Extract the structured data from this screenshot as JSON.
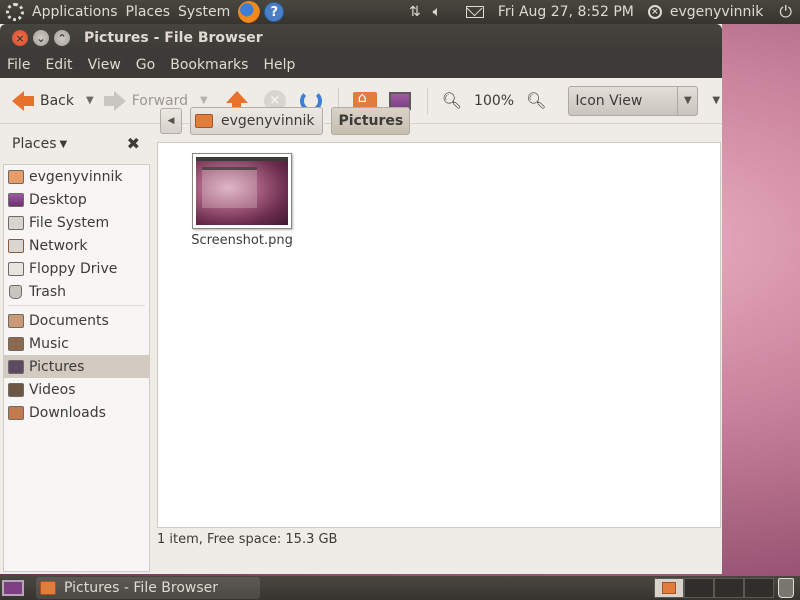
{
  "top_panel": {
    "applications": "Applications",
    "places": "Places",
    "system": "System",
    "help_icon_text": "?",
    "datetime": "Fri Aug 27,  8:52 PM",
    "username": "evgenyvinnik"
  },
  "window": {
    "title": "Pictures - File Browser"
  },
  "menubar": {
    "items": [
      "File",
      "Edit",
      "View",
      "Go",
      "Bookmarks",
      "Help"
    ]
  },
  "toolbar": {
    "back_label": "Back",
    "forward_label": "Forward",
    "zoom_level": "100%",
    "view_mode": "Icon View"
  },
  "sidebar": {
    "header": "Places",
    "items": [
      {
        "label": "evgenyvinnik",
        "icon": "home-folder-icon"
      },
      {
        "label": "Desktop",
        "icon": "desktop-icon"
      },
      {
        "label": "File System",
        "icon": "file-system-icon"
      },
      {
        "label": "Network",
        "icon": "network-icon"
      },
      {
        "label": "Floppy Drive",
        "icon": "floppy-icon"
      },
      {
        "label": "Trash",
        "icon": "trash-icon"
      },
      {
        "label": "Documents",
        "icon": "documents-folder-icon"
      },
      {
        "label": "Music",
        "icon": "music-folder-icon"
      },
      {
        "label": "Pictures",
        "icon": "pictures-folder-icon",
        "selected": true
      },
      {
        "label": "Videos",
        "icon": "videos-folder-icon"
      },
      {
        "label": "Downloads",
        "icon": "downloads-folder-icon"
      }
    ]
  },
  "pathbar": {
    "crumbs": [
      "evgenyvinnik",
      "Pictures"
    ]
  },
  "files": [
    {
      "name": "Screenshot.png"
    }
  ],
  "status": {
    "text": "1 item, Free space: 15.3 GB"
  },
  "taskbar": {
    "task_label": "Pictures - File Browser"
  },
  "colors": {
    "panel": "#3c3b37",
    "accent_orange": "#e8722c",
    "selection": "#d3cbc1"
  }
}
